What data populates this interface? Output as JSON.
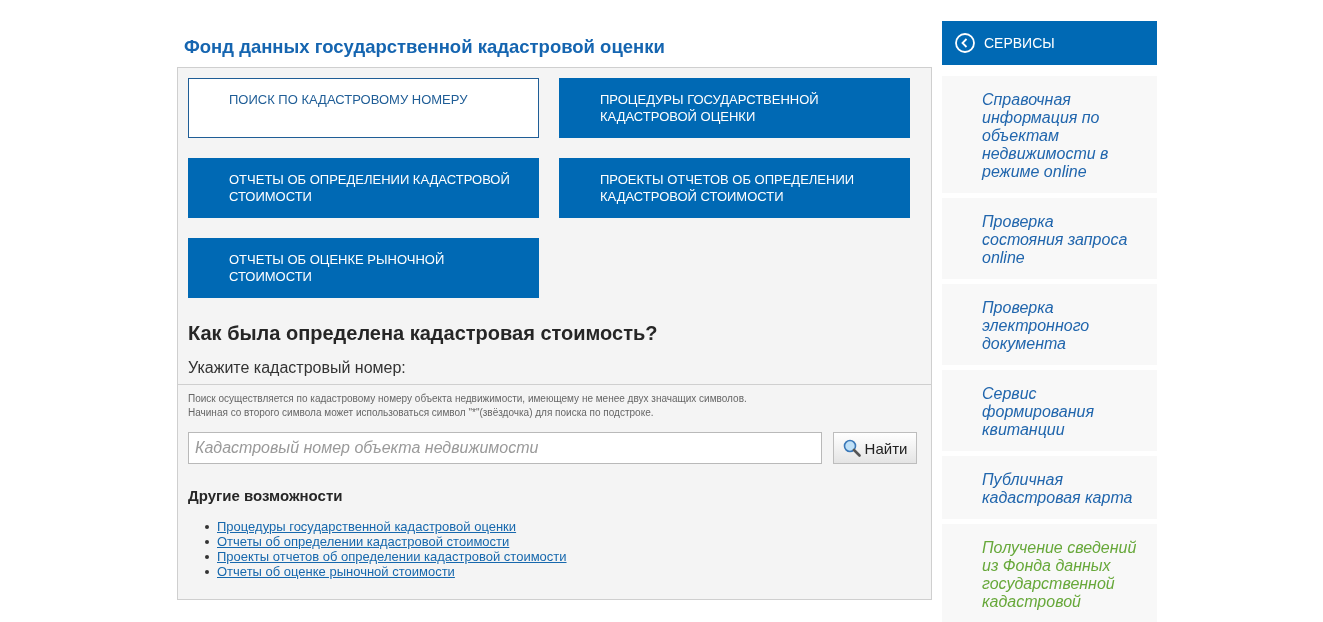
{
  "page_title": "Фонд данных государственной кадастровой оценки",
  "tiles": [
    {
      "label": "ПОИСК ПО КАДАСТРОВОМУ НОМЕРУ",
      "selected": true
    },
    {
      "label": "ПРОЦЕДУРЫ ГОСУДАРСТВЕННОЙ КАДАСТРОВОЙ ОЦЕНКИ",
      "selected": false
    },
    {
      "label": "ОТЧЕТЫ ОБ ОПРЕДЕЛЕНИИ КАДАСТРОВОЙ СТОИМОСТИ",
      "selected": false
    },
    {
      "label": "ПРОЕКТЫ ОТЧЕТОВ ОБ ОПРЕДЕЛЕНИИ КАДАСТРОВОЙ СТОИМОСТИ",
      "selected": false
    },
    {
      "label": "ОТЧЕТЫ ОБ ОЦЕНКЕ РЫНОЧНОЙ СТОИМОСТИ",
      "selected": false
    }
  ],
  "search_section": {
    "heading": "Как была определена кадастровая стоимость?",
    "prompt": "Укажите кадастровый номер:",
    "hints": [
      "Поиск осуществляется по кадастровому номеру объекта недвижимости, имеющему не менее двух значащих символов.",
      "Начиная со второго символа может использоваться символ \"*\"(звёздочка) для поиска по подстроке."
    ],
    "field": {
      "placeholder": "Кадастровый номер объекта недвижимости"
    },
    "button": "Найти"
  },
  "other_options": {
    "heading": "Другие возможности",
    "links": [
      "Процедуры государственной кадастровой оценки",
      "Отчеты об определении кадастровой стоимости",
      "Проекты отчетов об определении кадастровой стоимости",
      "Отчеты об оценке рыночной стоимости"
    ]
  },
  "sidebar": {
    "title": "СЕРВИСЫ",
    "items": [
      {
        "label": "Справочная информация по объектам недвижимости в режиме online",
        "selected": false
      },
      {
        "label": "Проверка состояния запроса online",
        "selected": false
      },
      {
        "label": "Проверка электронного документа",
        "selected": false
      },
      {
        "label": "Сервис формирования квитанции",
        "selected": false
      },
      {
        "label": "Публичная кадастровая карта",
        "selected": false
      },
      {
        "label": "Получение сведений из Фонда данных государственной кадастровой",
        "selected": true
      }
    ]
  }
}
